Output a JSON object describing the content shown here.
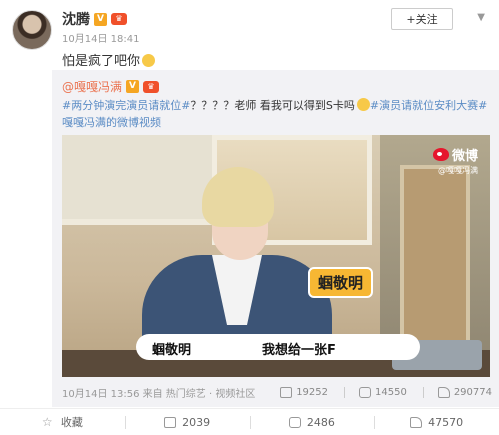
{
  "author": {
    "name": "沈腾",
    "timestamp": "10月14日 18:41",
    "follow_label": "+关注"
  },
  "post": {
    "text": "怕是疯了吧你"
  },
  "repost": {
    "author": "@嘎嘎冯满",
    "text_parts": [
      {
        "text": "#两分钟演完演员请就位#",
        "highlight": true
      },
      {
        "text": "？？？？老师 看我可以得到S卡吗",
        "highlight": false
      },
      {
        "text": "#演员请就位安利大赛#",
        "highlight": true
      },
      {
        "text": " 嘎嘎冯满的微博视频",
        "highlight": true
      }
    ],
    "video": {
      "watermark_brand": "微博",
      "watermark_handle": "@嘎嘎冯满",
      "name_tag": "蝈敬明",
      "subtitle_speaker": "蝈敬明",
      "subtitle_line": "我想给一张F"
    },
    "meta": "10月14日 13:56 来自 热门综艺 · 视频社区",
    "stats": {
      "shares": "19252",
      "comments": "14550",
      "likes": "290774"
    }
  },
  "actions": {
    "favorite": "收藏",
    "share": "2039",
    "comment": "2486",
    "like": "47570"
  }
}
